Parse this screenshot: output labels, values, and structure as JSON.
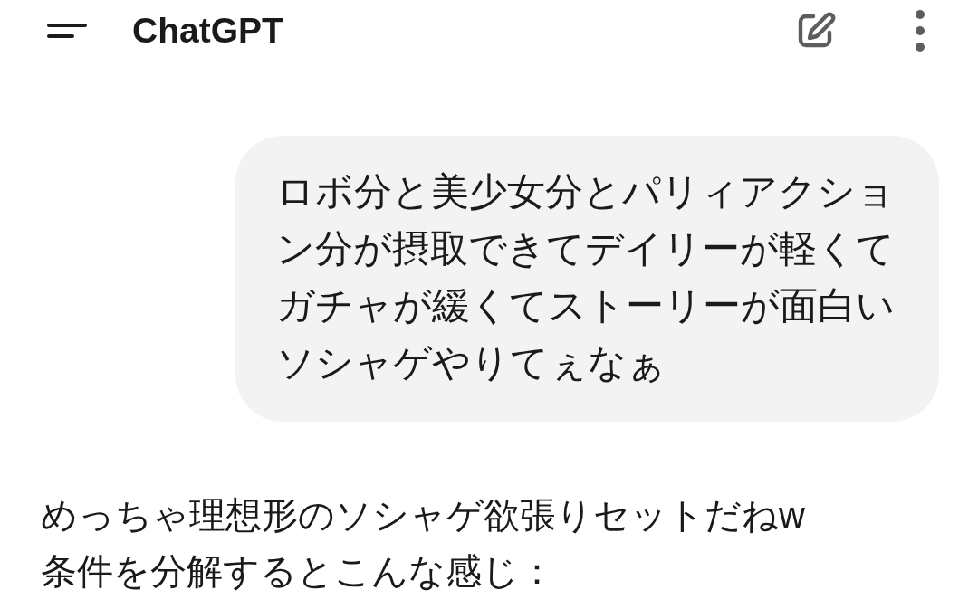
{
  "header": {
    "title": "ChatGPT"
  },
  "user_message": {
    "text": "ロボ分と美少女分とパリィアクション分が摂取できてデイリーが軽くてガチャが緩くてストーリーが面白いソシャゲやりてぇなぁ"
  },
  "assistant_message": {
    "lines": [
      "めっちゃ理想形のソシャゲ欲張りセットだねw",
      "条件を分解するとこんな感じ："
    ]
  }
}
